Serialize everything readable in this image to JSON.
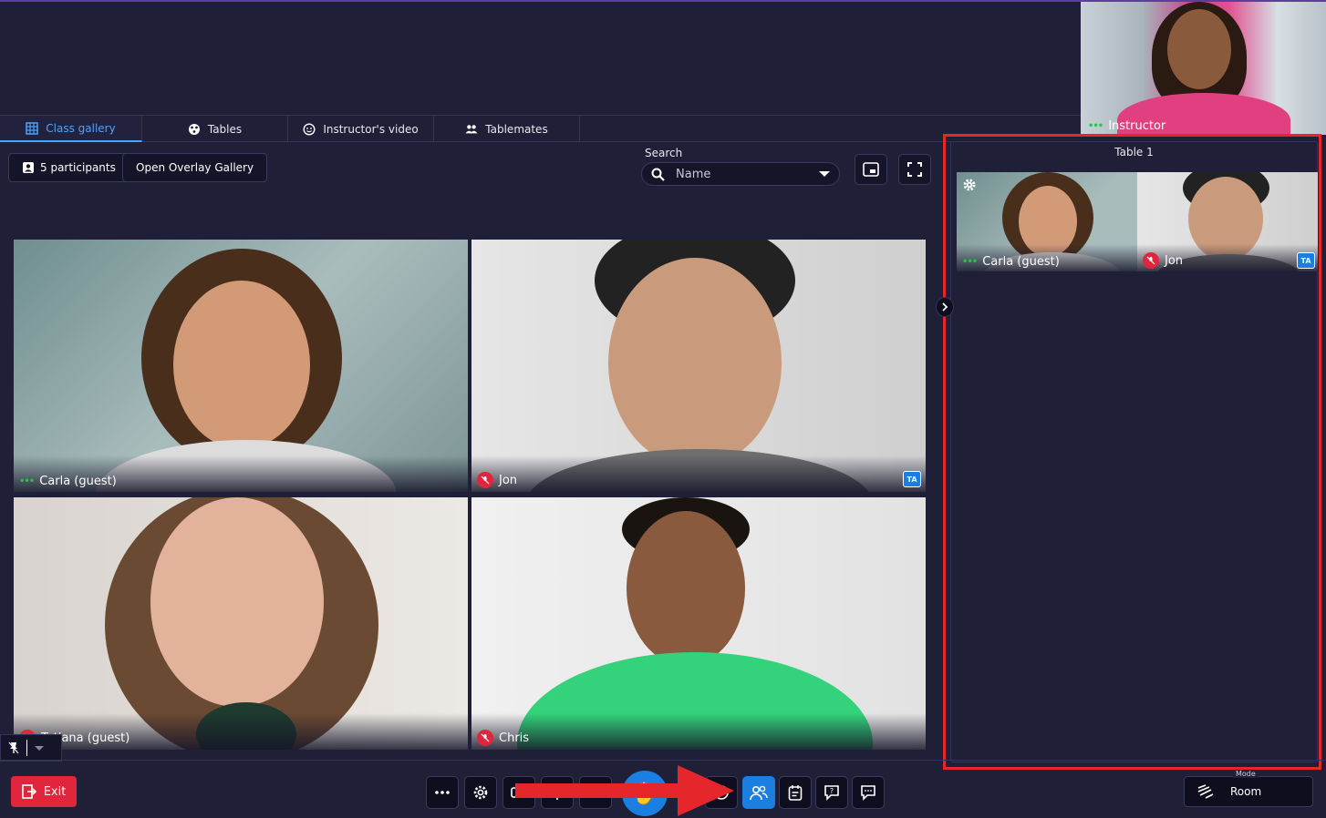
{
  "tabs": [
    {
      "label": "Class gallery",
      "icon": "grid-icon",
      "active": true
    },
    {
      "label": "Tables",
      "icon": "table-icon",
      "active": false
    },
    {
      "label": "Instructor's video",
      "icon": "face-icon",
      "active": false
    },
    {
      "label": "Tablemates",
      "icon": "people-icon",
      "active": false
    }
  ],
  "instructor": {
    "label": "Instructor"
  },
  "toolbar": {
    "participants_label": "5 participants",
    "overlay_label": "Open Overlay Gallery"
  },
  "search": {
    "label": "Search",
    "placeholder": "Name"
  },
  "gallery": [
    {
      "name": "Carla (guest)",
      "status": "audio-dots",
      "ta": false
    },
    {
      "name": "Jon",
      "status": "mic-off",
      "ta": true,
      "ta_label": "TA"
    },
    {
      "name": "Tatiana (guest)",
      "status": "mic-off",
      "ta": false
    },
    {
      "name": "Chris",
      "status": "mic-off",
      "ta": false
    }
  ],
  "panel": {
    "title": "Table 1",
    "members": [
      {
        "name": "Carla (guest)",
        "status": "audio-dots"
      },
      {
        "name": "Jon",
        "status": "mic-off",
        "ta_label": "TA"
      }
    ]
  },
  "bottom": {
    "exit_label": "Exit",
    "mode_label": "Mode",
    "mode_value": "Room"
  },
  "colors": {
    "background": "#1f1f38",
    "accent": "#1a7fe0",
    "danger": "#e0263c",
    "highlight_frame": "#e5262b"
  }
}
